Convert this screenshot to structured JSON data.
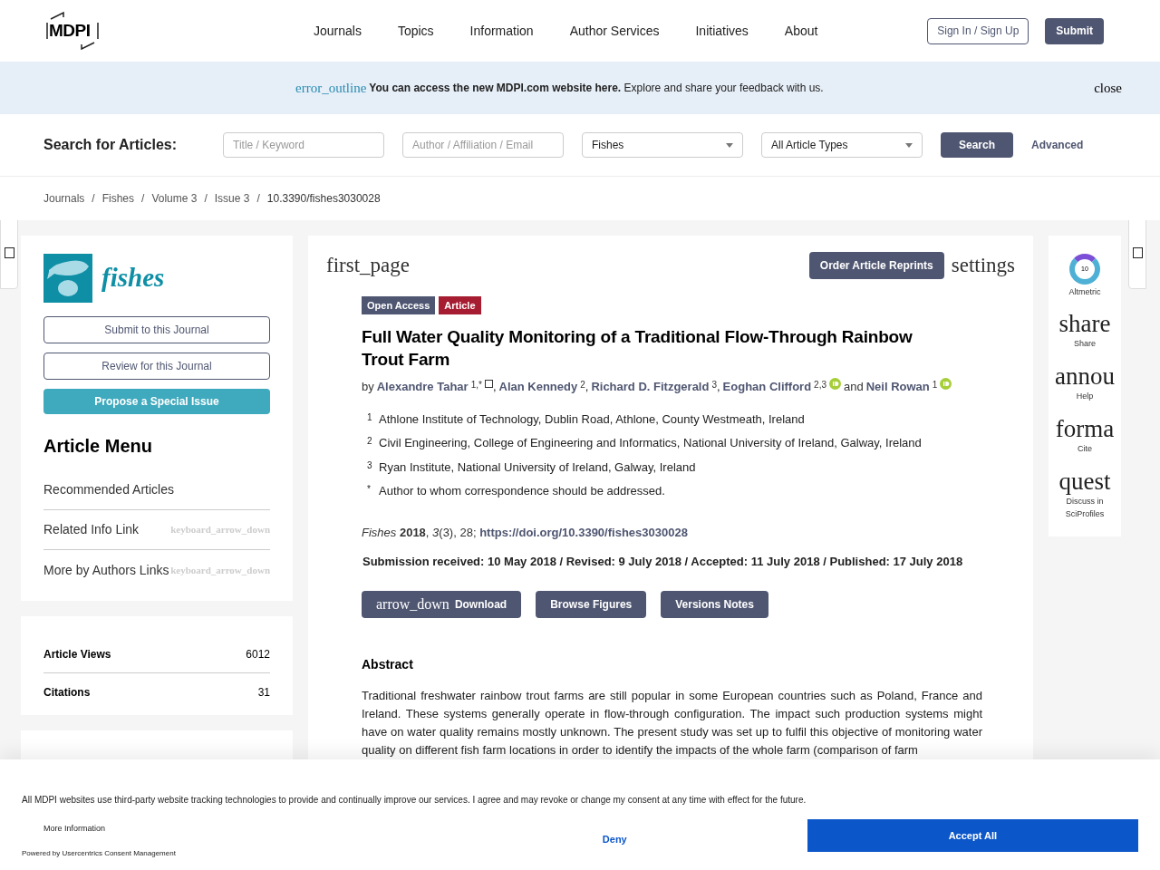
{
  "header": {
    "logo": "MDPI",
    "nav": [
      "Journals",
      "Topics",
      "Information",
      "Author Services",
      "Initiatives",
      "About"
    ],
    "buttons": [
      {
        "label": "Sign In / Sign Up",
        "kind": "outline"
      },
      {
        "label": "Submit",
        "kind": "filled"
      }
    ]
  },
  "notice": {
    "icon_text": "error_outline",
    "text": "You can access the new MDPI.com website here.",
    "text_rest": "Explore and share your feedback with us.",
    "close": "close"
  },
  "search": {
    "label": "Search for Articles:",
    "fields": [
      {
        "placeholder": "Title / Keyword",
        "kind": "text"
      },
      {
        "placeholder": "Author / Affiliation / Email",
        "kind": "text"
      },
      {
        "value": "Fishes",
        "kind": "select"
      },
      {
        "value": "All Article Types",
        "kind": "select"
      }
    ],
    "button": "Search",
    "advanced": "Advanced"
  },
  "breadcrumbs": [
    "Journals",
    "Fishes",
    "Volume 3",
    "Issue 3",
    "10.3390/fishes3030028"
  ],
  "breadcrumb_separator": "/",
  "sidebar": {
    "journal": "fishes",
    "buttons": [
      {
        "label": "Submit to this Journal",
        "kind": "outline"
      },
      {
        "label": "Review for this Journal",
        "kind": "outline"
      },
      {
        "label": "Propose a Special Issue",
        "kind": "filled"
      }
    ],
    "menu_title": "Article Menu",
    "menu": [
      {
        "label": "Recommended Articles"
      },
      {
        "label": "Related Info Link",
        "icon_text": "keyboard_arrow_down"
      },
      {
        "label": "More by Authors Links",
        "icon_text": "keyboard_arrow_down"
      }
    ],
    "stats": [
      {
        "label": "Article Views",
        "value": "6012"
      },
      {
        "label": "Citations",
        "value": "31"
      }
    ]
  },
  "article": {
    "first_page": "first_page",
    "reprints": "Order Article Reprints",
    "settings": "settings",
    "badges": [
      {
        "label": "Open Access",
        "color": "#4f5671"
      },
      {
        "label": "Article",
        "color": "#a61c31"
      }
    ],
    "title": "Full Water Quality Monitoring of a Traditional Flow-Through Rainbow Trout Farm",
    "by": "by",
    "authors": [
      {
        "name": "Alexandre Tahar",
        "sup": "1,*",
        "mail": true,
        "orcid": false,
        "after": ","
      },
      {
        "name": "Alan Kennedy",
        "sup": "2",
        "mail": false,
        "orcid": false,
        "after": ","
      },
      {
        "name": "Richard D. Fitzgerald",
        "sup": "3",
        "mail": false,
        "orcid": false,
        "after": ","
      },
      {
        "name": "Eoghan Clifford",
        "sup": "2,3",
        "mail": false,
        "orcid": true
      },
      {
        "name": "Neil Rowan",
        "sup": "1",
        "mail": false,
        "orcid": true
      }
    ],
    "and": "and",
    "affiliations": [
      {
        "mark": "1",
        "text": "Athlone Institute of Technology, Dublin Road, Athlone, County Westmeath, Ireland"
      },
      {
        "mark": "2",
        "text": "Civil Engineering, College of Engineering and Informatics, National University of Ireland, Galway, Ireland"
      },
      {
        "mark": "3",
        "text": "Ryan Institute, National University of Ireland, Galway, Ireland"
      },
      {
        "mark": "*",
        "text": "Author to whom correspondence should be addressed."
      }
    ],
    "citation": "*Fishes* **2018**, *3*(3), 28;",
    "doi": "https://doi.org/10.3390/fishes3030028",
    "dates": "Submission received: 10 May 2018 / Revised: 9 July 2018 / Accepted: 11 July 2018 / Published: 17 July 2018",
    "actions": [
      {
        "label": "Download",
        "icon_text": "arrow_down"
      },
      {
        "label": "Browse Figures"
      },
      {
        "label": "Versions Notes"
      }
    ],
    "abstract_title": "Abstract",
    "abstract": "Traditional freshwater rainbow trout farms are still popular in some European countries such as Poland, France and Ireland. These systems generally operate in flow-through configuration. The impact such production systems might have on water quality remains mostly unknown. The present study was set up to fulfil this objective of monitoring water quality on different fish farm locations in order to identify the impacts of the whole farm (comparison of farm"
  },
  "tools": [
    {
      "kind": "altmetric",
      "badge": "10",
      "label": "Altmetric"
    },
    {
      "kind": "tool",
      "icon_text": "share",
      "label": "Share"
    },
    {
      "kind": "tool",
      "icon_text": "annou",
      "label": "Help"
    },
    {
      "kind": "tool",
      "icon_text": "forma",
      "label": "Cite"
    },
    {
      "kind": "tool",
      "icon_text": "quest",
      "label": "Discuss in SciProfiles"
    }
  ],
  "cookie": {
    "text": "All MDPI websites use third-party website tracking technologies to provide and continually improve our services. I agree and may revoke or change my consent at any time with effect for the future.",
    "more": "More Information",
    "powered": "Powered by Usercentrics Consent Management",
    "deny": "Deny",
    "accept": "Accept All"
  }
}
